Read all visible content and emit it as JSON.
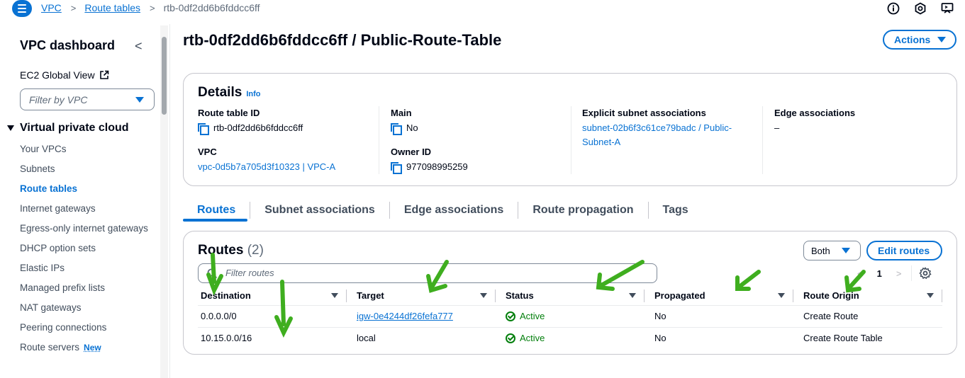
{
  "breadcrumb": {
    "root": "VPC",
    "parent": "Route tables",
    "current": "rtb-0df2dd6b6fddcc6ff"
  },
  "sidebar": {
    "title": "VPC dashboard",
    "ec2_global_view": "EC2 Global View",
    "filter_placeholder": "Filter by VPC",
    "section": "Virtual private cloud",
    "items": [
      {
        "label": "Your VPCs"
      },
      {
        "label": "Subnets"
      },
      {
        "label": "Route tables",
        "active": true
      },
      {
        "label": "Internet gateways"
      },
      {
        "label": "Egress-only internet gateways"
      },
      {
        "label": "DHCP option sets"
      },
      {
        "label": "Elastic IPs"
      },
      {
        "label": "Managed prefix lists"
      },
      {
        "label": "NAT gateways"
      },
      {
        "label": "Peering connections"
      },
      {
        "label": "Route servers",
        "badge": "New"
      }
    ]
  },
  "page": {
    "title": "rtb-0df2dd6b6fddcc6ff / Public-Route-Table",
    "actions_label": "Actions"
  },
  "details": {
    "heading": "Details",
    "info": "Info",
    "route_table_id_label": "Route table ID",
    "route_table_id": "rtb-0df2dd6b6fddcc6ff",
    "vpc_label": "VPC",
    "vpc_value": "vpc-0d5b7a705d3f10323 | VPC-A",
    "main_label": "Main",
    "main_value": "No",
    "owner_label": "Owner ID",
    "owner_value": "977098995259",
    "explicit_label": "Explicit subnet associations",
    "explicit_value_line1": "subnet-02b6f3c61ce79badc / Public-",
    "explicit_value_line2": "Subnet-A",
    "edge_label": "Edge associations",
    "edge_value": "–"
  },
  "tabs": [
    "Routes",
    "Subnet associations",
    "Edge associations",
    "Route propagation",
    "Tags"
  ],
  "routes": {
    "heading": "Routes",
    "count": "(2)",
    "both_label": "Both",
    "edit_label": "Edit routes",
    "filter_placeholder": "Filter routes",
    "page": "1",
    "columns": [
      "Destination",
      "Target",
      "Status",
      "Propagated",
      "Route Origin"
    ],
    "rows": [
      {
        "destination": "0.0.0.0/0",
        "target": "igw-0e4244df26fefa777",
        "status": "Active",
        "propagated": "No",
        "origin": "Create Route"
      },
      {
        "destination": "10.15.0.0/16",
        "target": "local",
        "status": "Active",
        "propagated": "No",
        "origin": "Create Route Table"
      }
    ]
  },
  "colors": {
    "accent": "#0972d3",
    "success": "#037f0c",
    "annotation_arrow": "#3fae1f"
  }
}
